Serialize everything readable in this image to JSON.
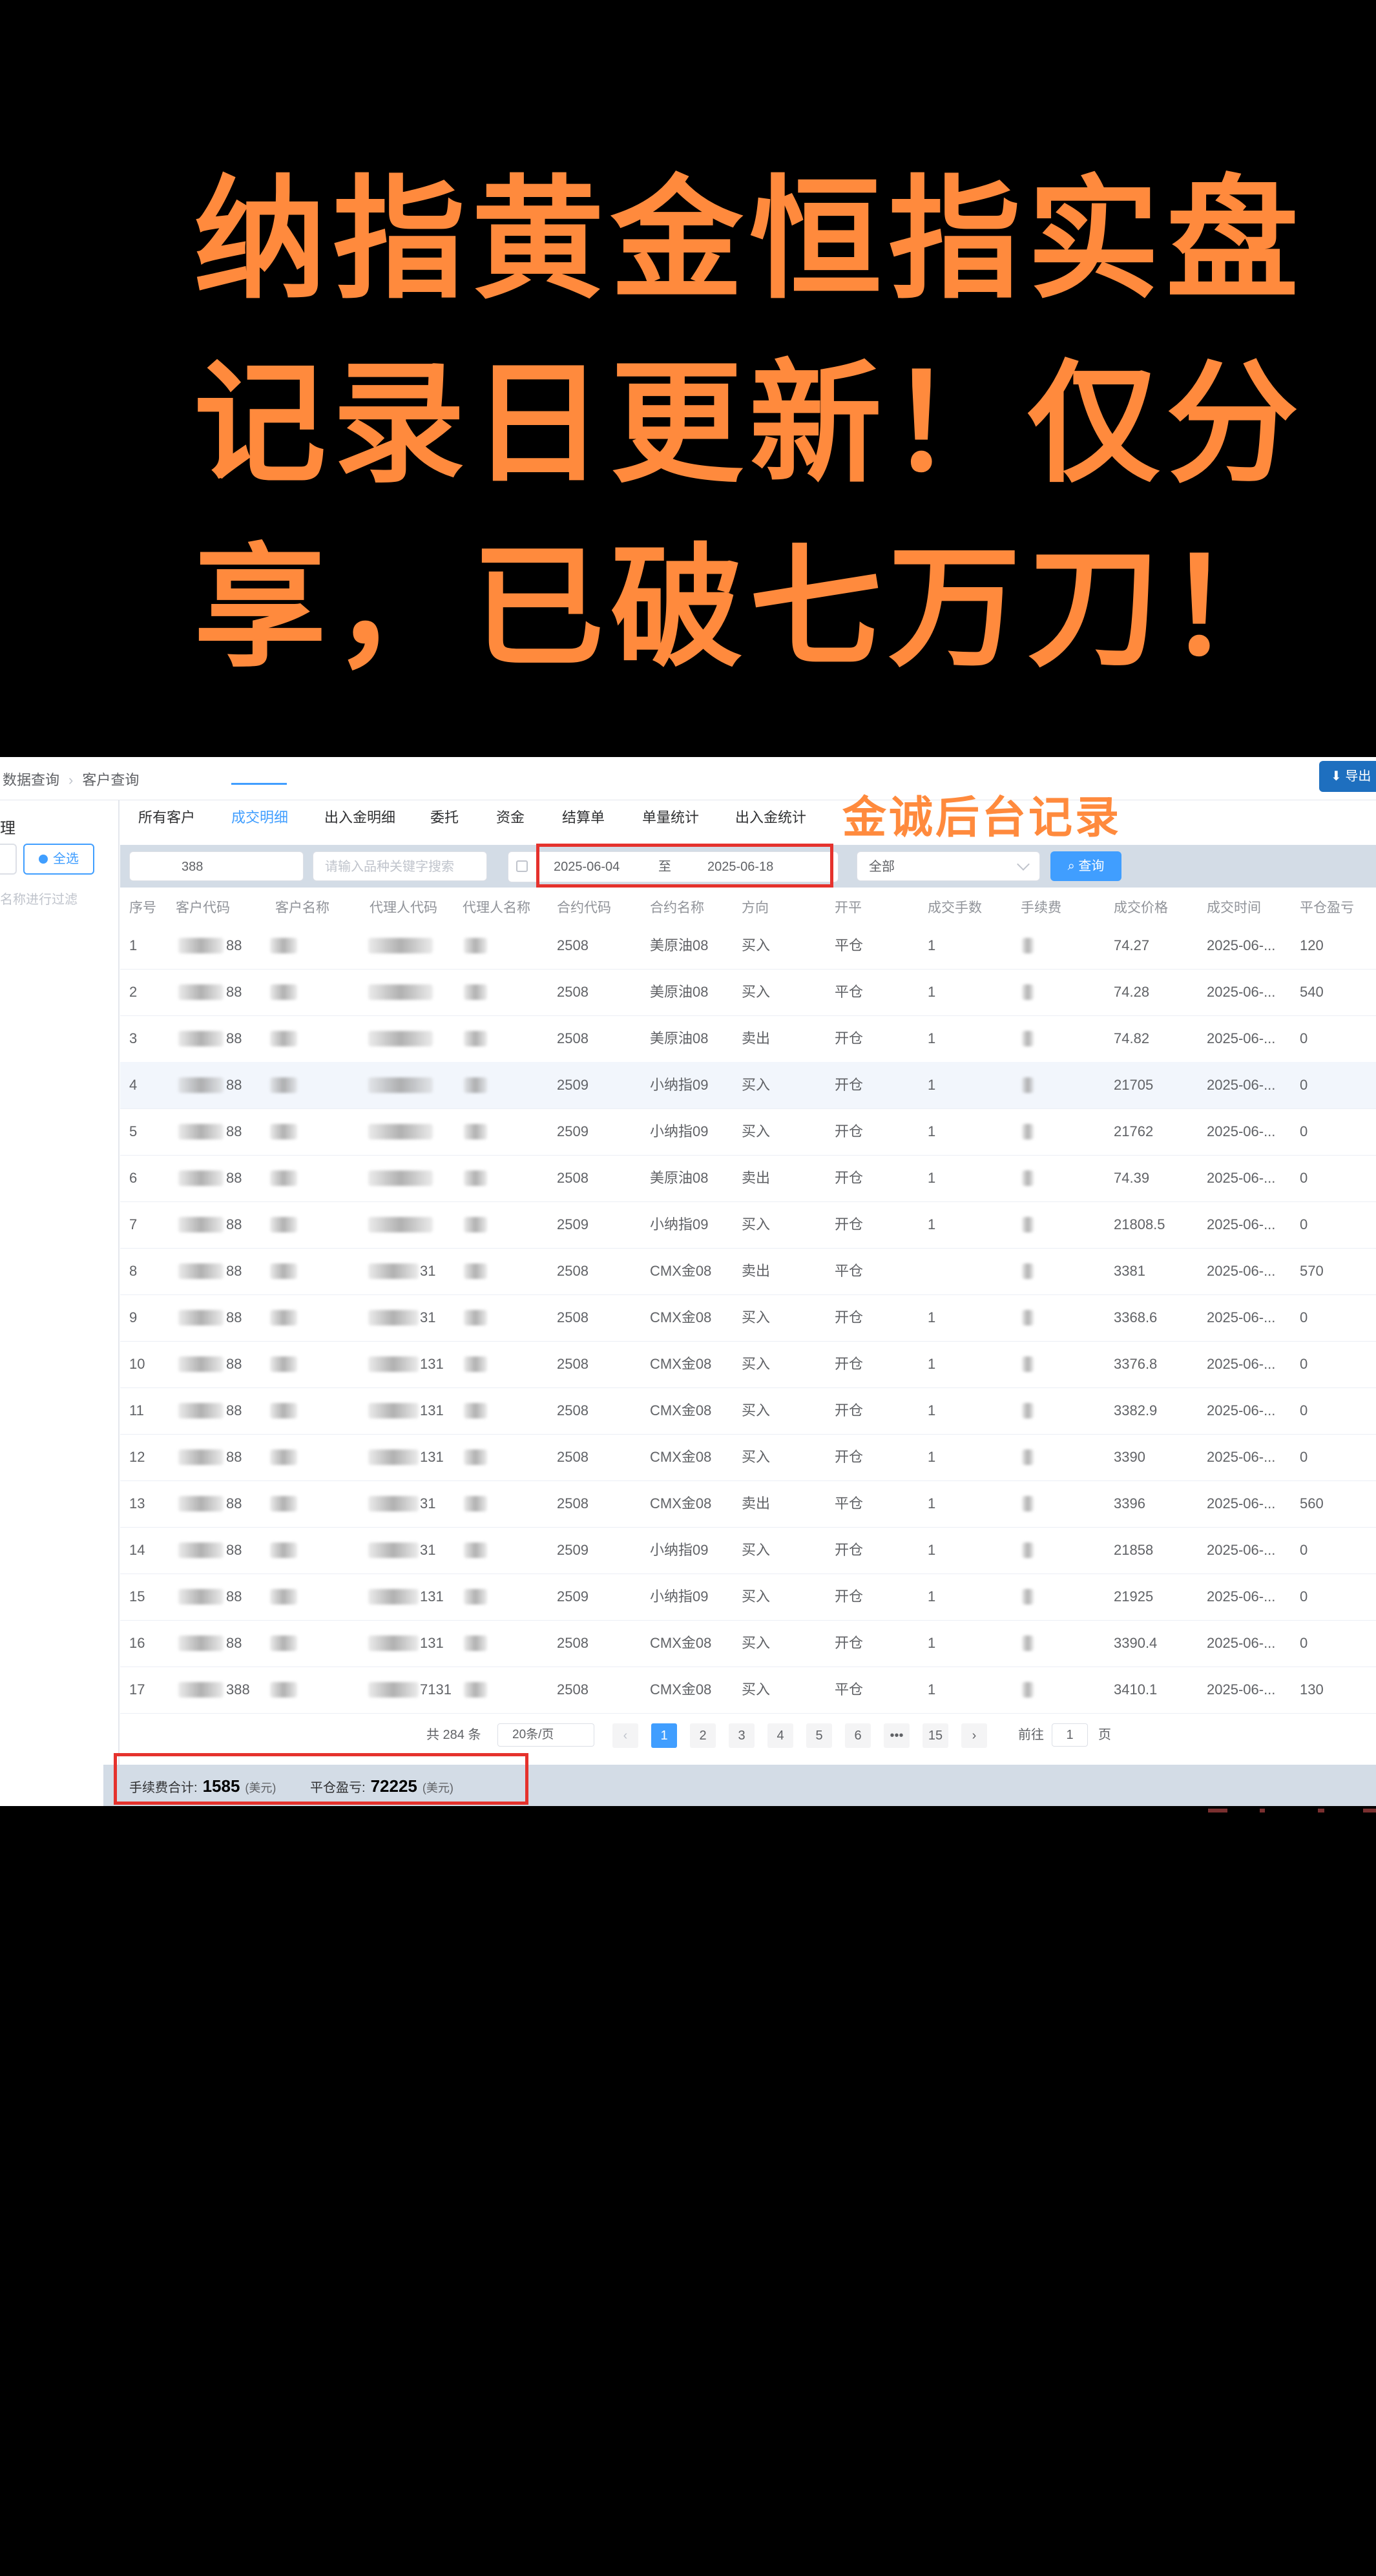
{
  "headline": {
    "line1": "纳指黄金恒指实盘",
    "line2": "记录日更新！仅分",
    "line3": "享，已破七万刀！"
  },
  "annotation": "金诚后台记录",
  "topbar": {
    "breadcrumb": [
      "数据查询",
      "客户查询"
    ],
    "export_label": "导出"
  },
  "sidebar": {
    "title": "理",
    "select_all": "全选",
    "filter_hint": "名称进行过滤"
  },
  "tabs": [
    "所有客户",
    "成交明细",
    "出入金明细",
    "委托",
    "资金",
    "结算单",
    "单量统计",
    "出入金统计"
  ],
  "filters": {
    "client_code": "388",
    "keyword_placeholder": "请输入品种关键字搜索",
    "date_start": "2025-06-04",
    "date_sep": "至",
    "date_end": "2025-06-18",
    "direction_select": "全部",
    "query_label": "查询"
  },
  "table": {
    "columns": [
      "序号",
      "客户代码",
      "客户名称",
      "代理人代码",
      "代理人名称",
      "合约代码",
      "合约名称",
      "方向",
      "开平",
      "成交手数",
      "手续费",
      "成交价格",
      "成交时间",
      "平仓盈亏"
    ],
    "rows": [
      {
        "no": "1",
        "client": "88",
        "agent": "",
        "code": "2508",
        "name": "美原油08",
        "dir": "买入",
        "oc": "平仓",
        "qty": "1",
        "price": "74.27",
        "time": "2025-06-...",
        "pnl": "120"
      },
      {
        "no": "2",
        "client": "88",
        "agent": "",
        "code": "2508",
        "name": "美原油08",
        "dir": "买入",
        "oc": "平仓",
        "qty": "1",
        "price": "74.28",
        "time": "2025-06-...",
        "pnl": "540"
      },
      {
        "no": "3",
        "client": "88",
        "agent": "",
        "code": "2508",
        "name": "美原油08",
        "dir": "卖出",
        "oc": "开仓",
        "qty": "1",
        "price": "74.82",
        "time": "2025-06-...",
        "pnl": "0"
      },
      {
        "no": "4",
        "client": "88",
        "agent": "",
        "code": "2509",
        "name": "小纳指09",
        "dir": "买入",
        "oc": "开仓",
        "qty": "1",
        "price": "21705",
        "time": "2025-06-...",
        "pnl": "0"
      },
      {
        "no": "5",
        "client": "88",
        "agent": "",
        "code": "2509",
        "name": "小纳指09",
        "dir": "买入",
        "oc": "开仓",
        "qty": "1",
        "price": "21762",
        "time": "2025-06-...",
        "pnl": "0"
      },
      {
        "no": "6",
        "client": "88",
        "agent": "",
        "code": "2508",
        "name": "美原油08",
        "dir": "卖出",
        "oc": "开仓",
        "qty": "1",
        "price": "74.39",
        "time": "2025-06-...",
        "pnl": "0"
      },
      {
        "no": "7",
        "client": "88",
        "agent": "",
        "code": "2509",
        "name": "小纳指09",
        "dir": "买入",
        "oc": "开仓",
        "qty": "1",
        "price": "21808.5",
        "time": "2025-06-...",
        "pnl": "0"
      },
      {
        "no": "8",
        "client": "88",
        "agent": "31",
        "code": "2508",
        "name": "CMX金08",
        "dir": "卖出",
        "oc": "平仓",
        "qty": "",
        "price": "3381",
        "time": "2025-06-...",
        "pnl": "570"
      },
      {
        "no": "9",
        "client": "88",
        "agent": "31",
        "code": "2508",
        "name": "CMX金08",
        "dir": "买入",
        "oc": "开仓",
        "qty": "1",
        "price": "3368.6",
        "time": "2025-06-...",
        "pnl": "0"
      },
      {
        "no": "10",
        "client": "88",
        "agent": "131",
        "code": "2508",
        "name": "CMX金08",
        "dir": "买入",
        "oc": "开仓",
        "qty": "1",
        "price": "3376.8",
        "time": "2025-06-...",
        "pnl": "0"
      },
      {
        "no": "11",
        "client": "88",
        "agent": "131",
        "code": "2508",
        "name": "CMX金08",
        "dir": "买入",
        "oc": "开仓",
        "qty": "1",
        "price": "3382.9",
        "time": "2025-06-...",
        "pnl": "0"
      },
      {
        "no": "12",
        "client": "88",
        "agent": "131",
        "code": "2508",
        "name": "CMX金08",
        "dir": "买入",
        "oc": "开仓",
        "qty": "1",
        "price": "3390",
        "time": "2025-06-...",
        "pnl": "0"
      },
      {
        "no": "13",
        "client": "88",
        "agent": "31",
        "code": "2508",
        "name": "CMX金08",
        "dir": "卖出",
        "oc": "平仓",
        "qty": "1",
        "price": "3396",
        "time": "2025-06-...",
        "pnl": "560"
      },
      {
        "no": "14",
        "client": "88",
        "agent": "31",
        "code": "2509",
        "name": "小纳指09",
        "dir": "买入",
        "oc": "开仓",
        "qty": "1",
        "price": "21858",
        "time": "2025-06-...",
        "pnl": "0"
      },
      {
        "no": "15",
        "client": "88",
        "agent": "131",
        "code": "2509",
        "name": "小纳指09",
        "dir": "买入",
        "oc": "开仓",
        "qty": "1",
        "price": "21925",
        "time": "2025-06-...",
        "pnl": "0"
      },
      {
        "no": "16",
        "client": "88",
        "agent": "131",
        "code": "2508",
        "name": "CMX金08",
        "dir": "买入",
        "oc": "开仓",
        "qty": "1",
        "price": "3390.4",
        "time": "2025-06-...",
        "pnl": "0"
      },
      {
        "no": "17",
        "client": "388",
        "agent": "7131",
        "code": "2508",
        "name": "CMX金08",
        "dir": "买入",
        "oc": "平仓",
        "qty": "1",
        "price": "3410.1",
        "time": "2025-06-...",
        "pnl": "130"
      }
    ]
  },
  "pagination": {
    "total": "共 284 条",
    "page_size": "20条/页",
    "prev": "‹",
    "pages": [
      "1",
      "2",
      "3",
      "4",
      "5",
      "6",
      "•••",
      "15"
    ],
    "next": "›",
    "goto_prefix": "前往",
    "goto_value": "1",
    "goto_suffix": "页"
  },
  "summary": {
    "fee_label": "手续费合计:",
    "fee_value": "1585",
    "fee_unit": "(美元)",
    "pnl_label": "平仓盈亏:",
    "pnl_value": "72225",
    "pnl_unit": "(美元)"
  },
  "colors": {
    "headline": "#ff8a3d",
    "accent": "#409eff",
    "highlight_box": "#e5322d",
    "filter_bg": "#d3dce6"
  }
}
